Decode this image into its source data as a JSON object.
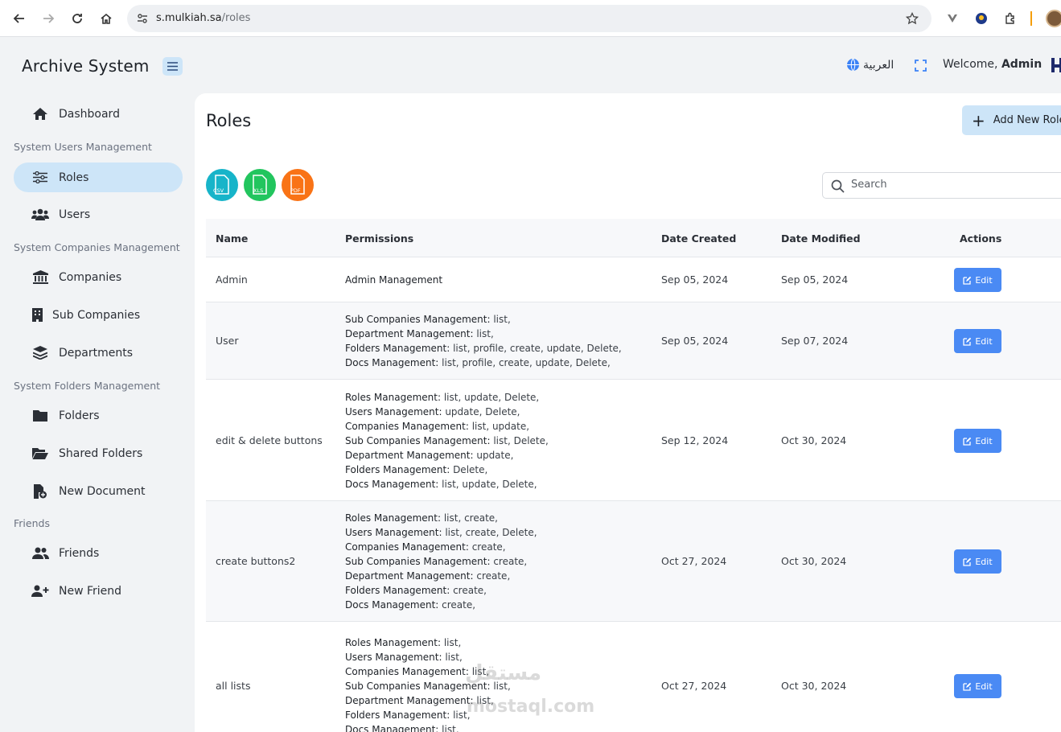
{
  "browser": {
    "url_host": "s.mulkiah.sa",
    "url_path": "/roles"
  },
  "app": {
    "title": "Archive System",
    "language_label": "العربية",
    "welcome_prefix": "Welcome,",
    "welcome_user": "Admin"
  },
  "sidebar": {
    "dashboard": "Dashboard",
    "section_users": "System Users Management",
    "roles": "Roles",
    "users": "Users",
    "section_companies": "System Companies Management",
    "companies": "Companies",
    "sub_companies": "Sub Companies",
    "departments": "Departments",
    "section_folders": "System Folders Management",
    "folders": "Folders",
    "shared_folders": "Shared Folders",
    "new_document": "New Document",
    "section_friends": "Friends",
    "friends": "Friends",
    "new_friend": "New Friend"
  },
  "page": {
    "title": "Roles",
    "add_button": "Add New Role",
    "search_placeholder": "Search",
    "export": {
      "csv": "CSV",
      "xls": "XLS",
      "pdf": "PDF"
    }
  },
  "table": {
    "headers": {
      "name": "Name",
      "permissions": "Permissions",
      "date_created": "Date Created",
      "date_modified": "Date Modified",
      "actions": "Actions"
    },
    "edit_label": "Edit",
    "rows": [
      {
        "name": "Admin",
        "created": "Sep 05, 2024",
        "modified": "Sep 05, 2024",
        "permissions": [
          {
            "group": "Admin Management",
            "actions": ""
          }
        ]
      },
      {
        "name": "User",
        "created": "Sep 05, 2024",
        "modified": "Sep 07, 2024",
        "permissions": [
          {
            "group": "Sub Companies Management:",
            "actions": " list,"
          },
          {
            "group": "Department Management:",
            "actions": " list,"
          },
          {
            "group": "Folders Management:",
            "actions": " list, profile, create, update, Delete,"
          },
          {
            "group": "Docs Management:",
            "actions": " list, profile, create, update, Delete,"
          }
        ]
      },
      {
        "name": "edit & delete buttons",
        "created": "Sep 12, 2024",
        "modified": "Oct 30, 2024",
        "permissions": [
          {
            "group": "Roles Management:",
            "actions": " list, update, Delete,"
          },
          {
            "group": "Users Management:",
            "actions": " update, Delete,"
          },
          {
            "group": "Companies Management:",
            "actions": " list, update,"
          },
          {
            "group": "Sub Companies Management:",
            "actions": " list, Delete,"
          },
          {
            "group": "Department Management:",
            "actions": " update,"
          },
          {
            "group": "Folders Management:",
            "actions": " Delete,"
          },
          {
            "group": "Docs Management:",
            "actions": " list, update, Delete,"
          }
        ]
      },
      {
        "name": "create buttons2",
        "created": "Oct 27, 2024",
        "modified": "Oct 30, 2024",
        "permissions": [
          {
            "group": "Roles Management:",
            "actions": " list, create,"
          },
          {
            "group": "Users Management:",
            "actions": " list, create, Delete,"
          },
          {
            "group": "Companies Management:",
            "actions": " create,"
          },
          {
            "group": "Sub Companies Management:",
            "actions": " create,"
          },
          {
            "group": "Department Management:",
            "actions": " create,"
          },
          {
            "group": "Folders Management:",
            "actions": " create,"
          },
          {
            "group": "Docs Management:",
            "actions": " create,"
          }
        ]
      },
      {
        "name": "all lists",
        "created": "Oct 27, 2024",
        "modified": "Oct 30, 2024",
        "permissions": [
          {
            "group": "Roles Management:",
            "actions": " list,"
          },
          {
            "group": "Users Management:",
            "actions": " list,"
          },
          {
            "group": "Companies Management:",
            "actions": " list,"
          },
          {
            "group": "Sub Companies Management:",
            "actions": " list,"
          },
          {
            "group": "Department Management:",
            "actions": " list,"
          },
          {
            "group": "Folders Management:",
            "actions": " list,"
          },
          {
            "group": "Docs Management:",
            "actions": " list,"
          }
        ]
      }
    ]
  },
  "watermark": {
    "arabic": "مستقل",
    "latin": "mostaql.com"
  },
  "colors": {
    "accent": "#cde5f8",
    "edit": "#4a8af4",
    "csv": "#17b4c9",
    "xls": "#22c55e",
    "pdf": "#f97316"
  }
}
